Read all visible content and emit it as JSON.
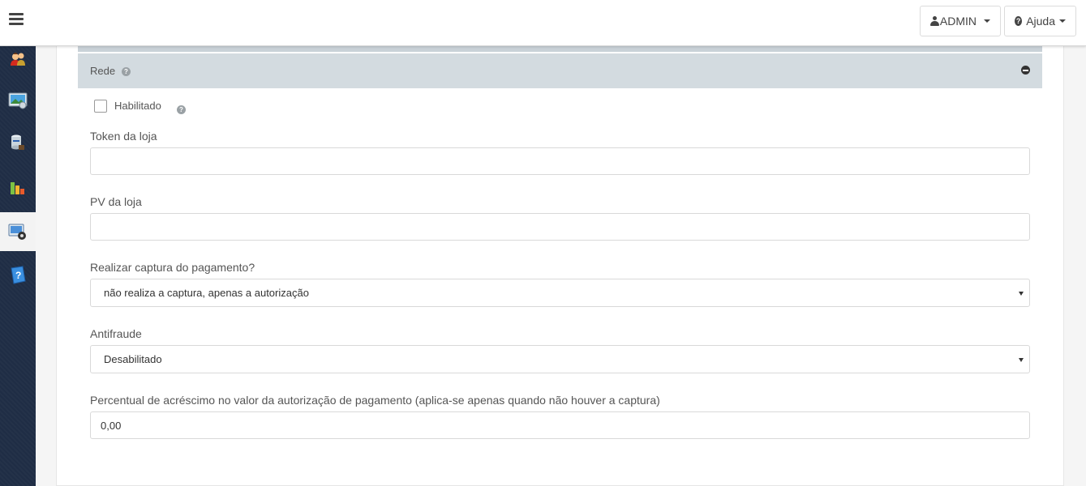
{
  "topbar": {
    "admin_label": "ADMIN",
    "help_label": "Ajuda"
  },
  "sidebar": {
    "items": [
      {
        "icon": "users-icon"
      },
      {
        "icon": "monitor-image-icon"
      },
      {
        "icon": "database-icon"
      },
      {
        "icon": "bar-chart-icon"
      },
      {
        "icon": "settings-icon",
        "active": true
      },
      {
        "icon": "help-book-icon"
      }
    ]
  },
  "section": {
    "title": "Rede"
  },
  "form": {
    "enabled_label": "Habilitado",
    "token_label": "Token da loja",
    "token_value": "",
    "pv_label": "PV da loja",
    "pv_value": "",
    "capture_label": "Realizar captura do pagamento?",
    "capture_value": "não realiza a captura, apenas a autorização",
    "antifraud_label": "Antifraude",
    "antifraud_value": "Desabilitado",
    "percent_label": "Percentual de acréscimo no valor da autorização de pagamento (aplica-se apenas quando não houver a captura)",
    "percent_value": "0,00"
  },
  "colors": {
    "sidebar_bg": "#1f2d45",
    "section_header_bg": "#d3dbe0"
  }
}
